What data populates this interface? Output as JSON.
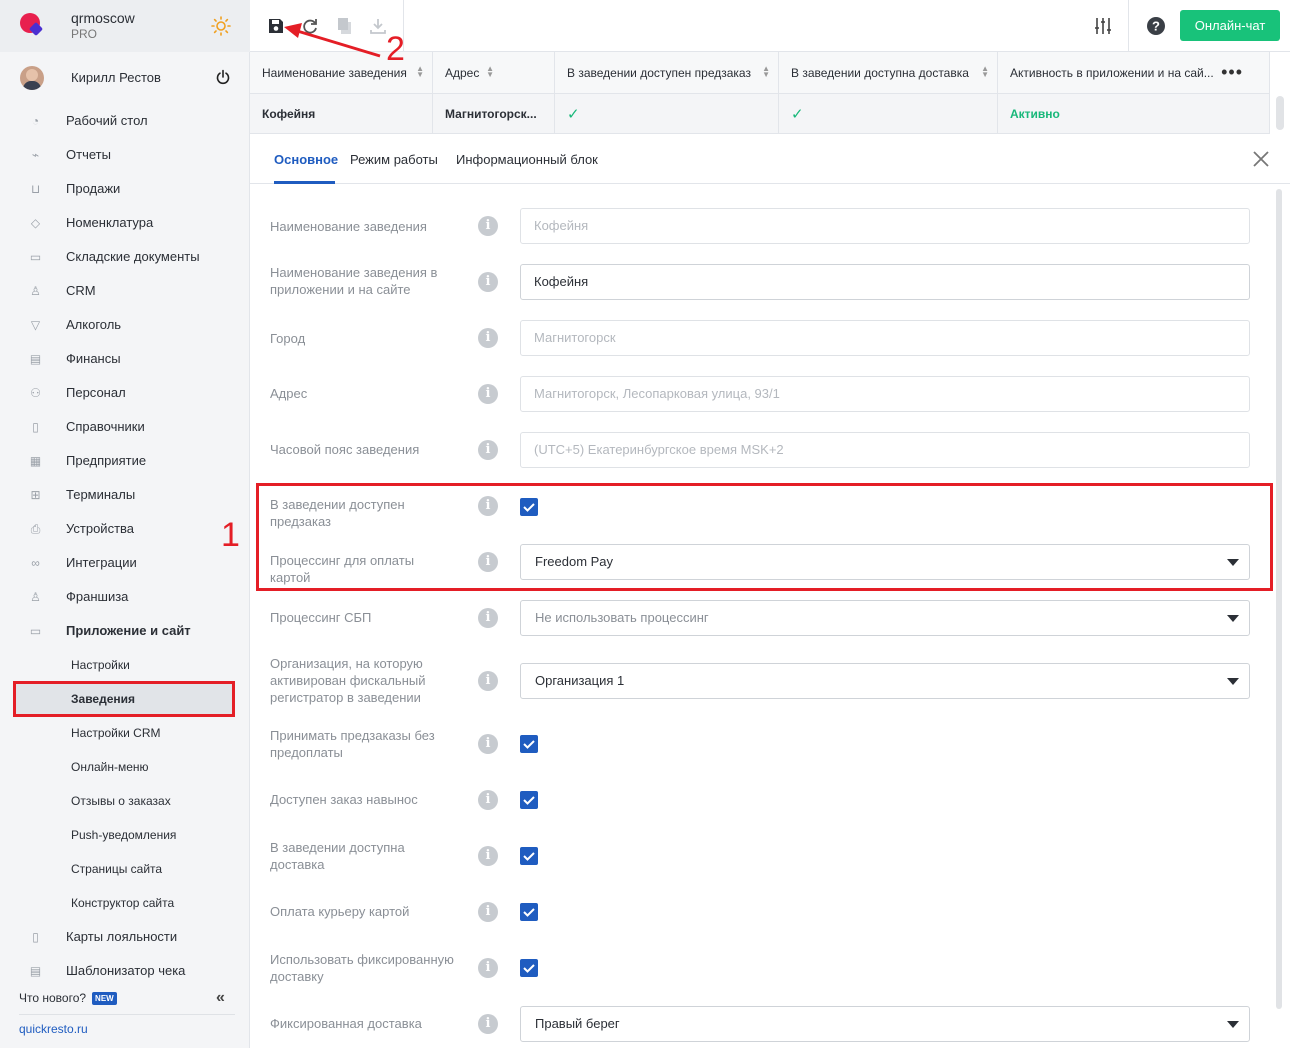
{
  "brand": {
    "name": "qrmoscow",
    "plan": "PRO"
  },
  "user": {
    "name": "Кирилл Рестов"
  },
  "nav": {
    "items": [
      {
        "label": "Рабочий стол",
        "icon": "speedometer-icon"
      },
      {
        "label": "Отчеты",
        "icon": "chart-icon"
      },
      {
        "label": "Продажи",
        "icon": "basket-icon"
      },
      {
        "label": "Номенклатура",
        "icon": "tag-icon"
      },
      {
        "label": "Складские документы",
        "icon": "box-icon"
      },
      {
        "label": "CRM",
        "icon": "crm-icon"
      },
      {
        "label": "Алкоголь",
        "icon": "glass-icon"
      },
      {
        "label": "Финансы",
        "icon": "wallet-icon"
      },
      {
        "label": "Персонал",
        "icon": "people-icon"
      },
      {
        "label": "Справочники",
        "icon": "book-icon"
      },
      {
        "label": "Предприятие",
        "icon": "building-icon"
      },
      {
        "label": "Терминалы",
        "icon": "qr-icon"
      },
      {
        "label": "Устройства",
        "icon": "printer-icon"
      },
      {
        "label": "Интеграции",
        "icon": "link-icon"
      },
      {
        "label": "Франшиза",
        "icon": "franchise-icon"
      },
      {
        "label": "Приложение и сайт",
        "icon": "app-icon"
      }
    ],
    "sub_items": [
      {
        "label": "Настройки"
      },
      {
        "label": "Заведения"
      },
      {
        "label": "Настройки CRM"
      },
      {
        "label": "Онлайн-меню"
      },
      {
        "label": "Отзывы о заказах"
      },
      {
        "label": "Push-уведомления"
      },
      {
        "label": "Страницы сайта"
      },
      {
        "label": "Конструктор сайта"
      }
    ],
    "bottom_items": [
      {
        "label": "Карты лояльности",
        "icon": "card-icon"
      },
      {
        "label": "Шаблонизатор чека",
        "icon": "receipt-icon"
      }
    ],
    "whats_new": "Что нового?",
    "new_badge": "NEW",
    "site_link": "quickresto.ru"
  },
  "markers": {
    "one": "1",
    "two": "2"
  },
  "topbar": {
    "chat_label": "Онлайн-чат"
  },
  "grid": {
    "headers": [
      "Наименование заведения",
      "Адрес",
      "В заведении доступен предзаказ",
      "В заведении доступна доставка",
      "Активность в приложении и на сай..."
    ],
    "row": {
      "name": "Кофейня",
      "address": "Магнитогорск...",
      "status": "Активно"
    }
  },
  "tabs": [
    "Основное",
    "Режим работы",
    "Информационный блок"
  ],
  "form": {
    "fields": [
      {
        "label": "Наименование заведения",
        "value": "Кофейня"
      },
      {
        "label": "Наименование заведения в приложении и на сайте",
        "value": "Кофейня"
      },
      {
        "label": "Город",
        "value": "Магнитогорск"
      },
      {
        "label": "Адрес",
        "value": "Магнитогорск, Лесопарковая улица, 93/1"
      },
      {
        "label": "Часовой пояс заведения",
        "value": "(UTC+5) Екатеринбургское время MSK+2"
      },
      {
        "label": "В заведении доступен предзаказ",
        "checked": true
      },
      {
        "label": "Процессинг для оплаты картой",
        "value": "Freedom Pay"
      },
      {
        "label": "Процессинг СБП",
        "value": "Не использовать процессинг"
      },
      {
        "label": "Организация, на которую активирован фискальный регистратор в заведении",
        "value": "Организация 1"
      },
      {
        "label": "Принимать предзаказы без предоплаты",
        "checked": true
      },
      {
        "label": "Доступен заказ навынос",
        "checked": true
      },
      {
        "label": "В заведении доступна доставка",
        "checked": true
      },
      {
        "label": "Оплата курьеру картой",
        "checked": true
      },
      {
        "label": "Использовать фиксированную доставку",
        "checked": true
      },
      {
        "label": "Фиксированная доставка",
        "value": "Правый берег"
      }
    ]
  },
  "colors": {
    "accent": "#1f5cc0",
    "success": "#18c27a",
    "highlight": "#e41e26"
  }
}
